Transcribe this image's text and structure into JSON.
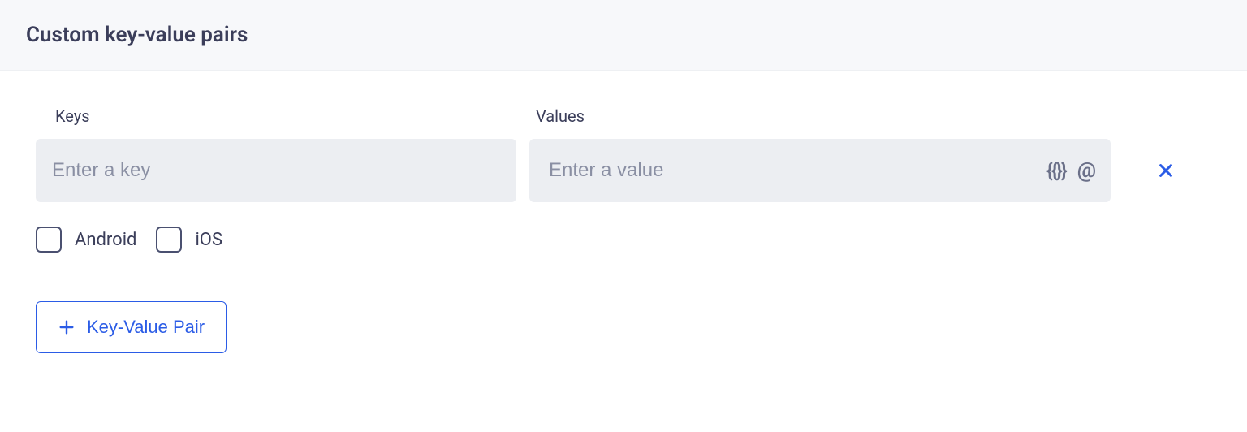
{
  "header": {
    "title": "Custom key-value pairs"
  },
  "labels": {
    "keys": "Keys",
    "values": "Values"
  },
  "inputs": {
    "key_placeholder": "Enter a key",
    "key_value": "",
    "value_placeholder": "Enter a value",
    "value_value": ""
  },
  "icons": {
    "braces": "{{}}",
    "at": "@"
  },
  "checkboxes": {
    "android": {
      "label": "Android",
      "checked": false
    },
    "ios": {
      "label": "iOS",
      "checked": false
    }
  },
  "buttons": {
    "add_pair": "Key-Value Pair"
  }
}
